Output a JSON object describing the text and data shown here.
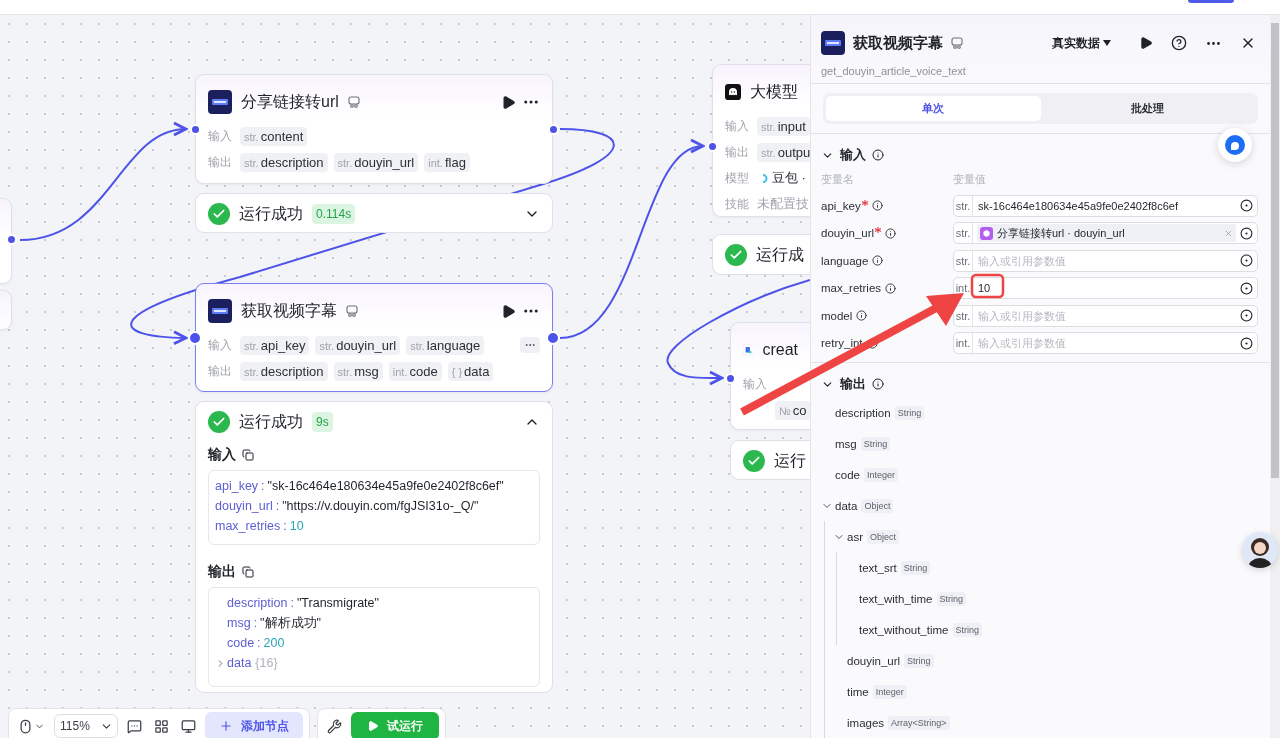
{
  "canvas": {
    "nodes": [
      {
        "kind": "plugin",
        "title": "分享链接转url",
        "selected": false,
        "actions": true,
        "rows": [
          {
            "label": "输入",
            "tags": [
              {
                "type": "str.",
                "name": "content"
              }
            ]
          },
          {
            "label": "输出",
            "tags": [
              {
                "type": "str.",
                "name": "description"
              },
              {
                "type": "str.",
                "name": "douyin_url"
              },
              {
                "type": "int.",
                "name": "flag"
              }
            ]
          }
        ],
        "status": {
          "text": "运行成功",
          "time": "0.114s",
          "expanded": false
        }
      },
      {
        "kind": "plugin",
        "title": "获取视频字幕",
        "selected": true,
        "actions": true,
        "rows": [
          {
            "label": "输入",
            "more": true,
            "tags": [
              {
                "type": "str.",
                "name": "api_key"
              },
              {
                "type": "str.",
                "name": "douyin_url"
              },
              {
                "type": "str.",
                "name": "language"
              }
            ]
          },
          {
            "label": "输出",
            "tags": [
              {
                "type": "str.",
                "name": "description"
              },
              {
                "type": "str.",
                "name": "msg"
              },
              {
                "type": "int.",
                "name": "code"
              },
              {
                "type": "{ }",
                "name": "data"
              }
            ]
          }
        ],
        "status": {
          "text": "运行成功",
          "time": "9s",
          "expanded": true,
          "separator": ":",
          "input_title": "输入",
          "input": [
            {
              "key": "api_key",
              "value": "\"sk-16c464e180634e45a9fe0e2402f8c6ef\"",
              "kind": "string"
            },
            {
              "key": "douyin_url",
              "value": "\"https://v.douyin.com/fgJSI31o-_Q/\"",
              "kind": "string"
            },
            {
              "key": "max_retries",
              "value": "10",
              "kind": "number"
            }
          ],
          "output_title": "输出",
          "output": [
            {
              "key": "description",
              "value": "\"Transmigrate\"",
              "kind": "string"
            },
            {
              "key": "msg",
              "value": "\"解析成功\"",
              "kind": "string"
            },
            {
              "key": "code",
              "value": "200",
              "kind": "number"
            },
            {
              "key": "data",
              "value": "{16}",
              "kind": "object"
            }
          ]
        }
      },
      {
        "kind": "llm",
        "title": "大模型",
        "selected": false,
        "rows": [
          {
            "label": "输入",
            "tags": [
              {
                "type": "str.",
                "name": "input"
              }
            ]
          },
          {
            "label": "输出",
            "tags": [
              {
                "type": "str.",
                "name": "outpu"
              }
            ]
          },
          {
            "label": "模型",
            "model": "豆包 ·"
          },
          {
            "label": "技能",
            "note": "未配置技"
          }
        ],
        "status": {
          "text": "运行成",
          "expanded": false
        }
      },
      {
        "kind": "doc",
        "title": "creat",
        "selected": false,
        "rows": [
          {
            "label": "输入"
          },
          {
            "tags": [
              {
                "type": "№",
                "name": "co"
              }
            ]
          }
        ],
        "status": {
          "text": "运行",
          "expanded": false
        }
      }
    ]
  },
  "toolbar": {
    "zoom": "115%",
    "add_node": "添加节点",
    "test_run": "试运行"
  },
  "panel": {
    "title": "获取视频字幕",
    "subtitle": "get_douyin_article_voice_text",
    "data_mode": "真实数据",
    "tabs": [
      {
        "label": "单次",
        "selected": true
      },
      {
        "label": "批处理",
        "selected": false
      }
    ],
    "inputs": {
      "title": "输入",
      "expanded": true,
      "name_header": "变量名",
      "value_header": "变量值",
      "fields": [
        {
          "name": "api_key",
          "required": true,
          "type": "str.",
          "value": "sk-16c464e180634e45a9fe0e2402f8c6ef"
        },
        {
          "name": "douyin_url",
          "required": true,
          "type": "str.",
          "reference": "分享链接转url · douyin_url"
        },
        {
          "name": "language",
          "type": "str.",
          "placeholder": "输入或引用参数值"
        },
        {
          "name": "max_retries",
          "type": "int.",
          "value": "10"
        },
        {
          "name": "model",
          "type": "str.",
          "placeholder": "输入或引用参数值"
        },
        {
          "name": "retry_int",
          "type": "int.",
          "placeholder": "输入或引用参数值"
        }
      ]
    },
    "outputs": {
      "title": "输出",
      "expanded": true,
      "fields": [
        {
          "name": "description",
          "type": "String"
        },
        {
          "name": "msg",
          "type": "String"
        },
        {
          "name": "code",
          "type": "Integer"
        },
        {
          "name": "data",
          "type": "Object",
          "expanded": true,
          "children": [
            {
              "name": "asr",
              "type": "Object",
              "expanded": true,
              "children": [
                {
                  "name": "text_srt",
                  "type": "String"
                },
                {
                  "name": "text_with_time",
                  "type": "String"
                },
                {
                  "name": "text_without_time",
                  "type": "String"
                }
              ]
            },
            {
              "name": "douyin_url",
              "type": "String"
            },
            {
              "name": "time",
              "type": "Integer"
            },
            {
              "name": "images",
              "type": "Array<String>"
            }
          ]
        }
      ]
    }
  }
}
